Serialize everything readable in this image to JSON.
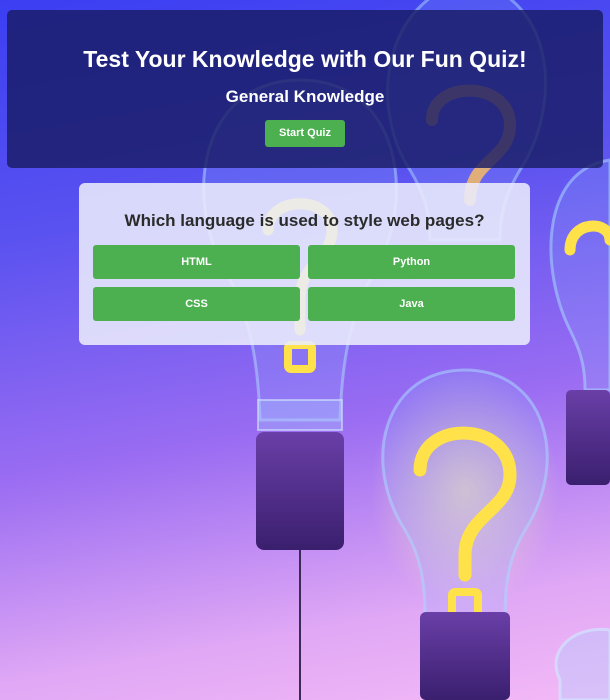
{
  "header": {
    "title": "Test Your Knowledge with Our Fun Quiz!",
    "subtitle": "General Knowledge",
    "start_label": "Start Quiz"
  },
  "quiz": {
    "question": "Which language is used to style web pages?",
    "answers": [
      "HTML",
      "Python",
      "CSS",
      "Java"
    ]
  },
  "colors": {
    "button_green": "#4caf50",
    "header_bg": "#181c64",
    "accent_yellow": "#ffe14a"
  },
  "background": {
    "icon": "question-mark-lightbulb-icon"
  }
}
